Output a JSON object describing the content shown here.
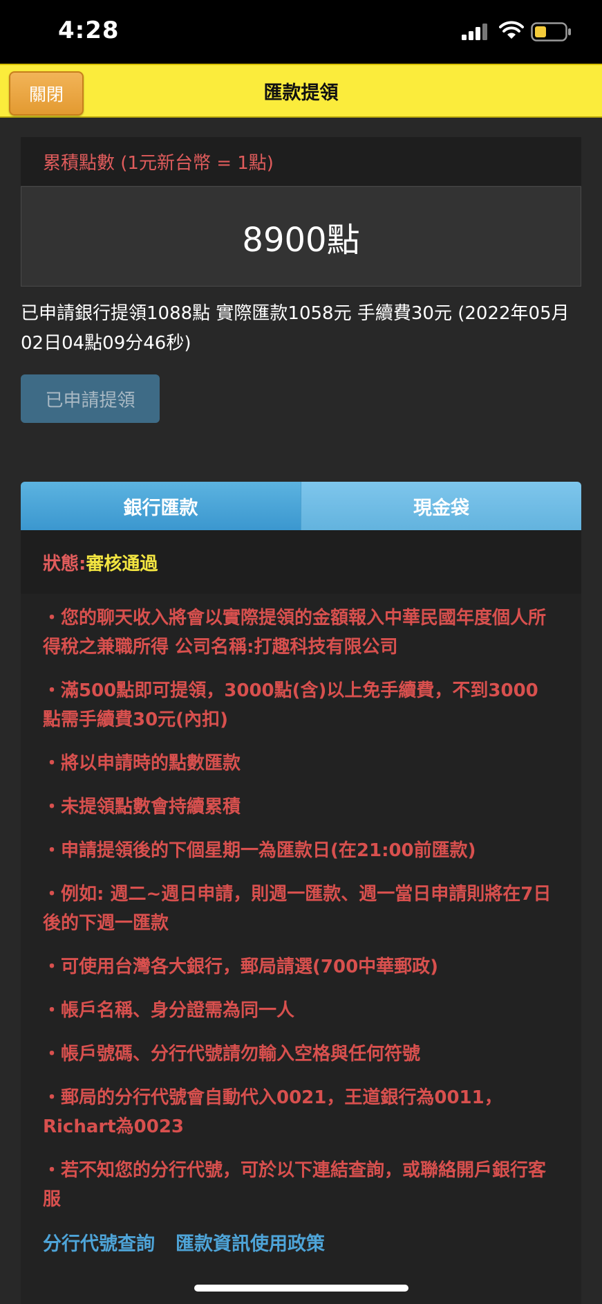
{
  "status_bar": {
    "time": "4:28"
  },
  "header": {
    "close_label": "關閉",
    "title": "匯款提領"
  },
  "points": {
    "label": "累積點數 (1元新台幣 = 1點)",
    "value": "8900點"
  },
  "request": {
    "text": "已申請銀行提領1088點 實際匯款1058元 手續費30元 (2022年05月02日04點09分46秒)",
    "button_label": "已申請提領"
  },
  "tabs": [
    {
      "label": "銀行匯款"
    },
    {
      "label": "現金袋"
    }
  ],
  "status": {
    "label": "狀態:",
    "value": "審核通過"
  },
  "notes": [
    "・您的聊天收入將會以實際提領的金額報入中華民國年度個人所得稅之兼職所得 公司名稱:打趣科技有限公司",
    "・滿500點即可提領，3000點(含)以上免手續費，不到3000點需手續費30元(內扣)",
    "・將以申請時的點數匯款",
    "・未提領點數會持續累積",
    "・申請提領後的下個星期一為匯款日(在21:00前匯款)",
    "・例如: 週二~週日申請，則週一匯款、週一當日申請則將在7日後的下週一匯款",
    "・可使用台灣各大銀行，郵局請選(700中華郵政)",
    "・帳戶名稱、身分證需為同一人",
    "・帳戶號碼、分行代號請勿輸入空格與任何符號",
    "・郵局的分行代號會自動代入0021，王道銀行為0011，Richart為0023",
    "・若不知您的分行代號，可於以下連結查詢，或聯絡開戶銀行客服"
  ],
  "links": {
    "branch_lookup": "分行代號查詢",
    "privacy_policy": "匯款資訊使用政策"
  },
  "colors": {
    "header_bg": "#fbec3c",
    "close_button": "#e8a23c",
    "tab_blue": "#4aa6d8",
    "note_red": "#d8504e",
    "status_yellow": "#f3e541",
    "link_blue": "#4ea4d8"
  }
}
